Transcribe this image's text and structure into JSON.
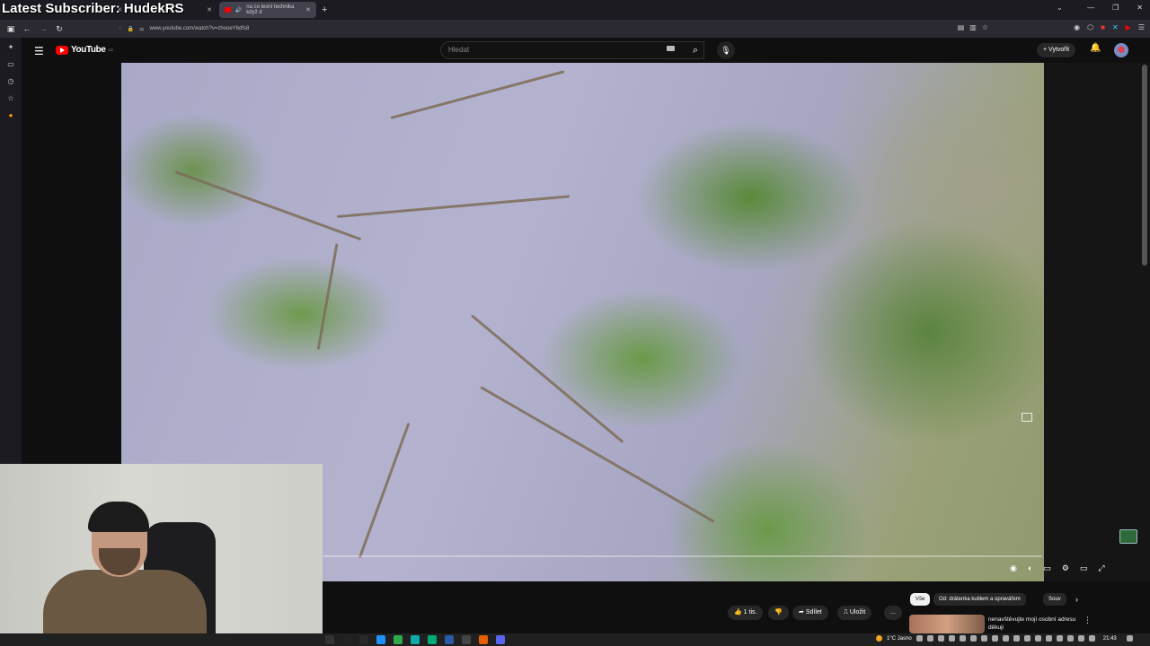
{
  "overlay": {
    "text": "Latest Subscriber: HudekRS"
  },
  "browser": {
    "tabs": [
      {
        "label": "",
        "active": false
      },
      {
        "label": "na co lesní technika když d",
        "active": true
      }
    ],
    "new_tab": "+",
    "url": "www.youtube.com/watch?v=zhooeY6dfs8"
  },
  "youtube": {
    "logo_text": "YouTube",
    "logo_country": "CZ",
    "search_placeholder": "Hledat",
    "create_label": "Vytvořit"
  },
  "actions": {
    "likes": "1 tis.",
    "share": "Sdílet",
    "save": "Uložit",
    "more": "..."
  },
  "chips": [
    {
      "label": "Vše",
      "active": true
    },
    {
      "label": "Od: drátenka kutilem a opravářem",
      "active": false
    },
    {
      "label": "Souv",
      "active": false
    }
  ],
  "recommendation": {
    "title": "nenavštěvujte mojí osobní adresu děkuji"
  },
  "taskbar": {
    "weather": "1°C Jasno",
    "time": "21:43"
  },
  "colors": {
    "youtube_red": "#ff0000",
    "background": "#0f0f0f"
  }
}
